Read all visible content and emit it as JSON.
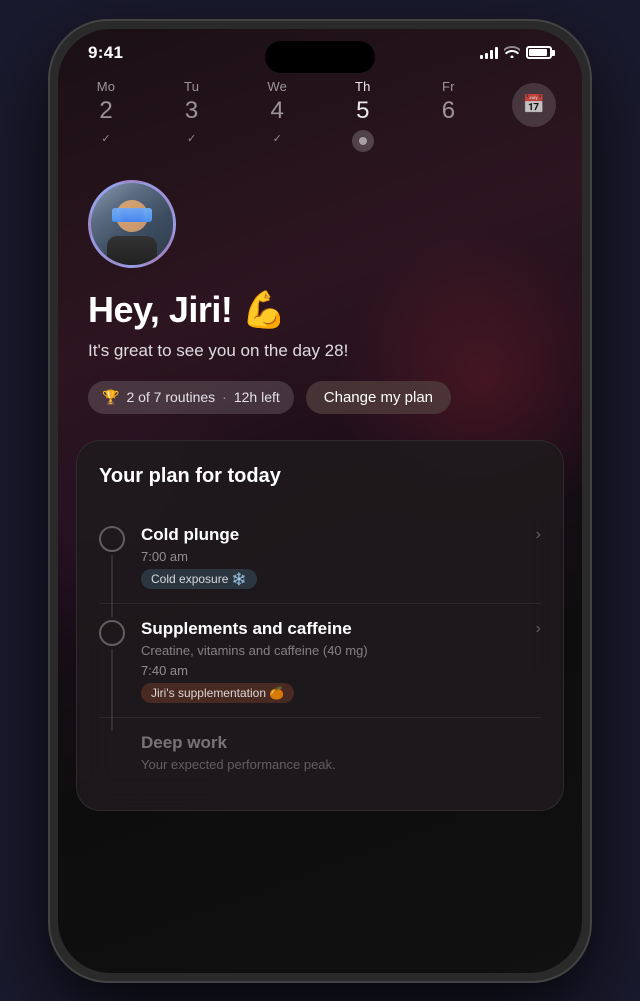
{
  "phone": {
    "frame_bg": "#1a1a2e"
  },
  "status_bar": {
    "time": "9:41",
    "signal_alt": "signal bars",
    "wifi_alt": "wifi",
    "battery_alt": "battery"
  },
  "week_nav": {
    "days": [
      {
        "name": "Mo",
        "number": "2",
        "status": "checked",
        "active": false
      },
      {
        "name": "Tu",
        "number": "3",
        "status": "checked",
        "active": false
      },
      {
        "name": "We",
        "number": "4",
        "status": "checked",
        "active": false
      },
      {
        "name": "Th",
        "number": "5",
        "status": "active-dot",
        "active": true
      },
      {
        "name": "Fr",
        "number": "6",
        "status": "none",
        "active": false
      }
    ],
    "calendar_btn_alt": "calendar"
  },
  "greeting": {
    "title": "Hey, Jiri! 💪",
    "subtitle": "It's great to see you on the day 28!"
  },
  "stats": {
    "routines_text": "2 of 7 routines",
    "time_left": "12h left",
    "change_plan_label": "Change my plan"
  },
  "plan_card": {
    "title": "Your plan for today",
    "items": [
      {
        "title": "Cold plunge",
        "time": "7:00 am",
        "tag": "Cold exposure ❄️",
        "tag_type": "blue",
        "subtitle": ""
      },
      {
        "title": "Supplements and caffeine",
        "time": "7:40 am",
        "tag": "Jiri's supplementation 🍊",
        "tag_type": "orange",
        "subtitle": "Creatine, vitamins and caffeine (40 mg)"
      },
      {
        "title": "Deep work",
        "time": "",
        "tag": "",
        "tag_type": "",
        "subtitle": "Your expected performance peak.",
        "dimmed": true
      }
    ]
  }
}
